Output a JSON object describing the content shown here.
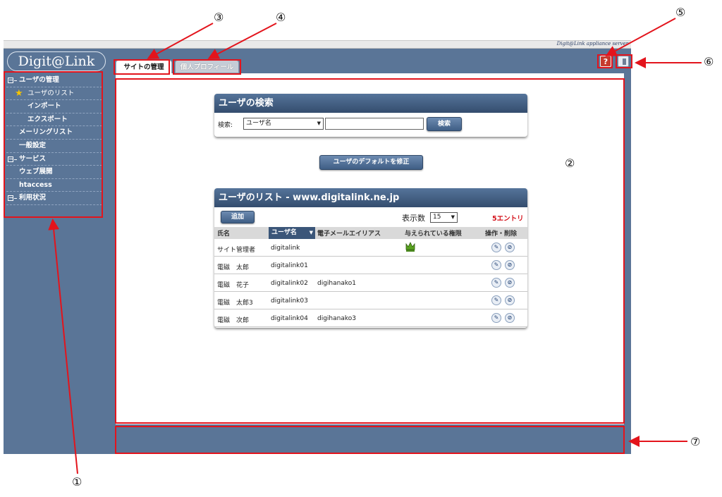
{
  "header": {
    "brand": "Digit@Link appliance server"
  },
  "sidebar": {
    "logo": "Digit@Link",
    "menu": [
      {
        "label": "ユーザの管理",
        "kind": "group"
      },
      {
        "label": "ユーザのリスト",
        "kind": "active"
      },
      {
        "label": "インポート",
        "kind": "sub"
      },
      {
        "label": "エクスポート",
        "kind": "sub"
      },
      {
        "label": "メーリングリスト",
        "kind": "item"
      },
      {
        "label": "一般設定",
        "kind": "item"
      },
      {
        "label": "サービス",
        "kind": "group"
      },
      {
        "label": "ウェブ展開",
        "kind": "item"
      },
      {
        "label": "htaccess",
        "kind": "item"
      },
      {
        "label": "利用状況",
        "kind": "group"
      }
    ]
  },
  "tabs": {
    "site": "サイトの管理",
    "profile": "個人プロフィール"
  },
  "buttons": {
    "help": "?"
  },
  "search": {
    "title": "ユーザの検索",
    "label": "検索:",
    "select_value": "ユーザ名",
    "button": "検索"
  },
  "default_button": "ユーザのデフォルトを修正",
  "user_list": {
    "title": "ユーザのリスト - www.digitalink.ne.jp",
    "add_button": "追加",
    "per_page_label": "表示数",
    "per_page_value": "15",
    "entry_count": "5エントリ",
    "columns": {
      "name": "氏名",
      "username": "ユーザ名",
      "email_alias": "電子メールエイリアス",
      "permissions": "与えられている権限",
      "actions": "操作・削除"
    },
    "rows": [
      {
        "name": "サイト管理者",
        "username": "digitalink",
        "alias": "",
        "admin": true
      },
      {
        "name": "電磁　太郎",
        "username": "digitalink01",
        "alias": "",
        "admin": false
      },
      {
        "name": "電磁　花子",
        "username": "digitalink02",
        "alias": "digihanako1",
        "admin": false
      },
      {
        "name": "電磁　太郎3",
        "username": "digitalink03",
        "alias": "",
        "admin": false
      },
      {
        "name": "電磁　次郎",
        "username": "digitalink04",
        "alias": "digihanako3",
        "admin": false
      }
    ]
  },
  "callouts": [
    "①",
    "②",
    "③",
    "④",
    "⑤",
    "⑥",
    "⑦"
  ],
  "colors": {
    "frame": "#5a7597",
    "title_bar": "#3b5679",
    "annotation": "#e3141c",
    "entry_count": "#d4121b"
  }
}
